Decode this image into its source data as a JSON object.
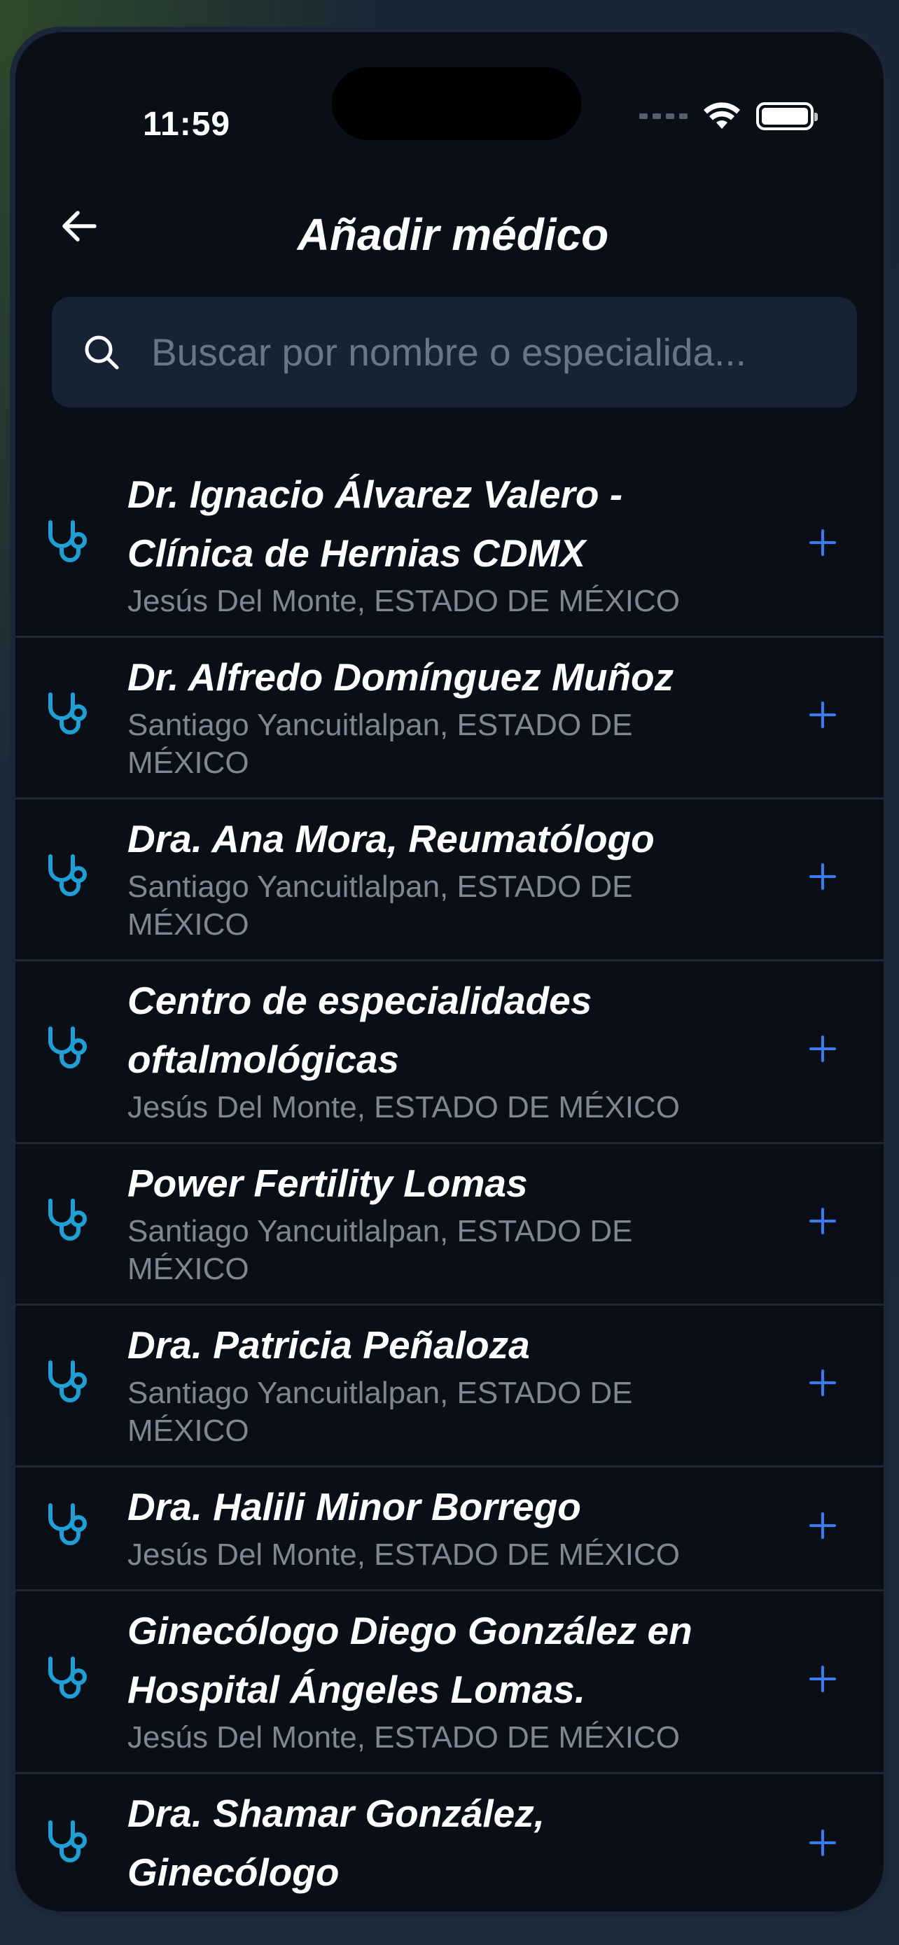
{
  "status_bar": {
    "time": "11:59"
  },
  "header": {
    "title": "Añadir médico"
  },
  "search": {
    "placeholder": "Buscar por nombre o especialida..."
  },
  "doctors": [
    {
      "name": "Dr. Ignacio Álvarez Valero - Clínica de Hernias CDMX",
      "location": "Jesús Del Monte, ESTADO DE MÉXICO"
    },
    {
      "name": "Dr. Alfredo Domínguez Muñoz",
      "location": "Santiago Yancuitlalpan, ESTADO DE MÉXICO"
    },
    {
      "name": "Dra. Ana Mora, Reumatólogo",
      "location": "Santiago Yancuitlalpan, ESTADO DE MÉXICO"
    },
    {
      "name": "Centro de especialidades oftalmológicas",
      "location": "Jesús Del Monte, ESTADO DE MÉXICO"
    },
    {
      "name": "Power Fertility Lomas",
      "location": "Santiago Yancuitlalpan, ESTADO DE MÉXICO"
    },
    {
      "name": "Dra. Patricia Peñaloza",
      "location": "Santiago Yancuitlalpan, ESTADO DE MÉXICO"
    },
    {
      "name": "Dra. Halili Minor Borrego",
      "location": "Jesús Del Monte, ESTADO DE MÉXICO"
    },
    {
      "name": "Ginecólogo Diego González en Hospital Ángeles Lomas.",
      "location": "Jesús Del Monte, ESTADO DE MÉXICO"
    },
    {
      "name": "Dra. Shamar González, Ginecólogo",
      "location": ""
    }
  ],
  "colors": {
    "background": "#090e17",
    "accent_add": "#3b7bf0",
    "stethoscope": "#1f9fd4",
    "secondary_text": "#7e8794"
  },
  "icons": {
    "back": "arrow-left-icon",
    "search": "search-icon",
    "item": "stethoscope-icon",
    "add": "plus-icon"
  }
}
